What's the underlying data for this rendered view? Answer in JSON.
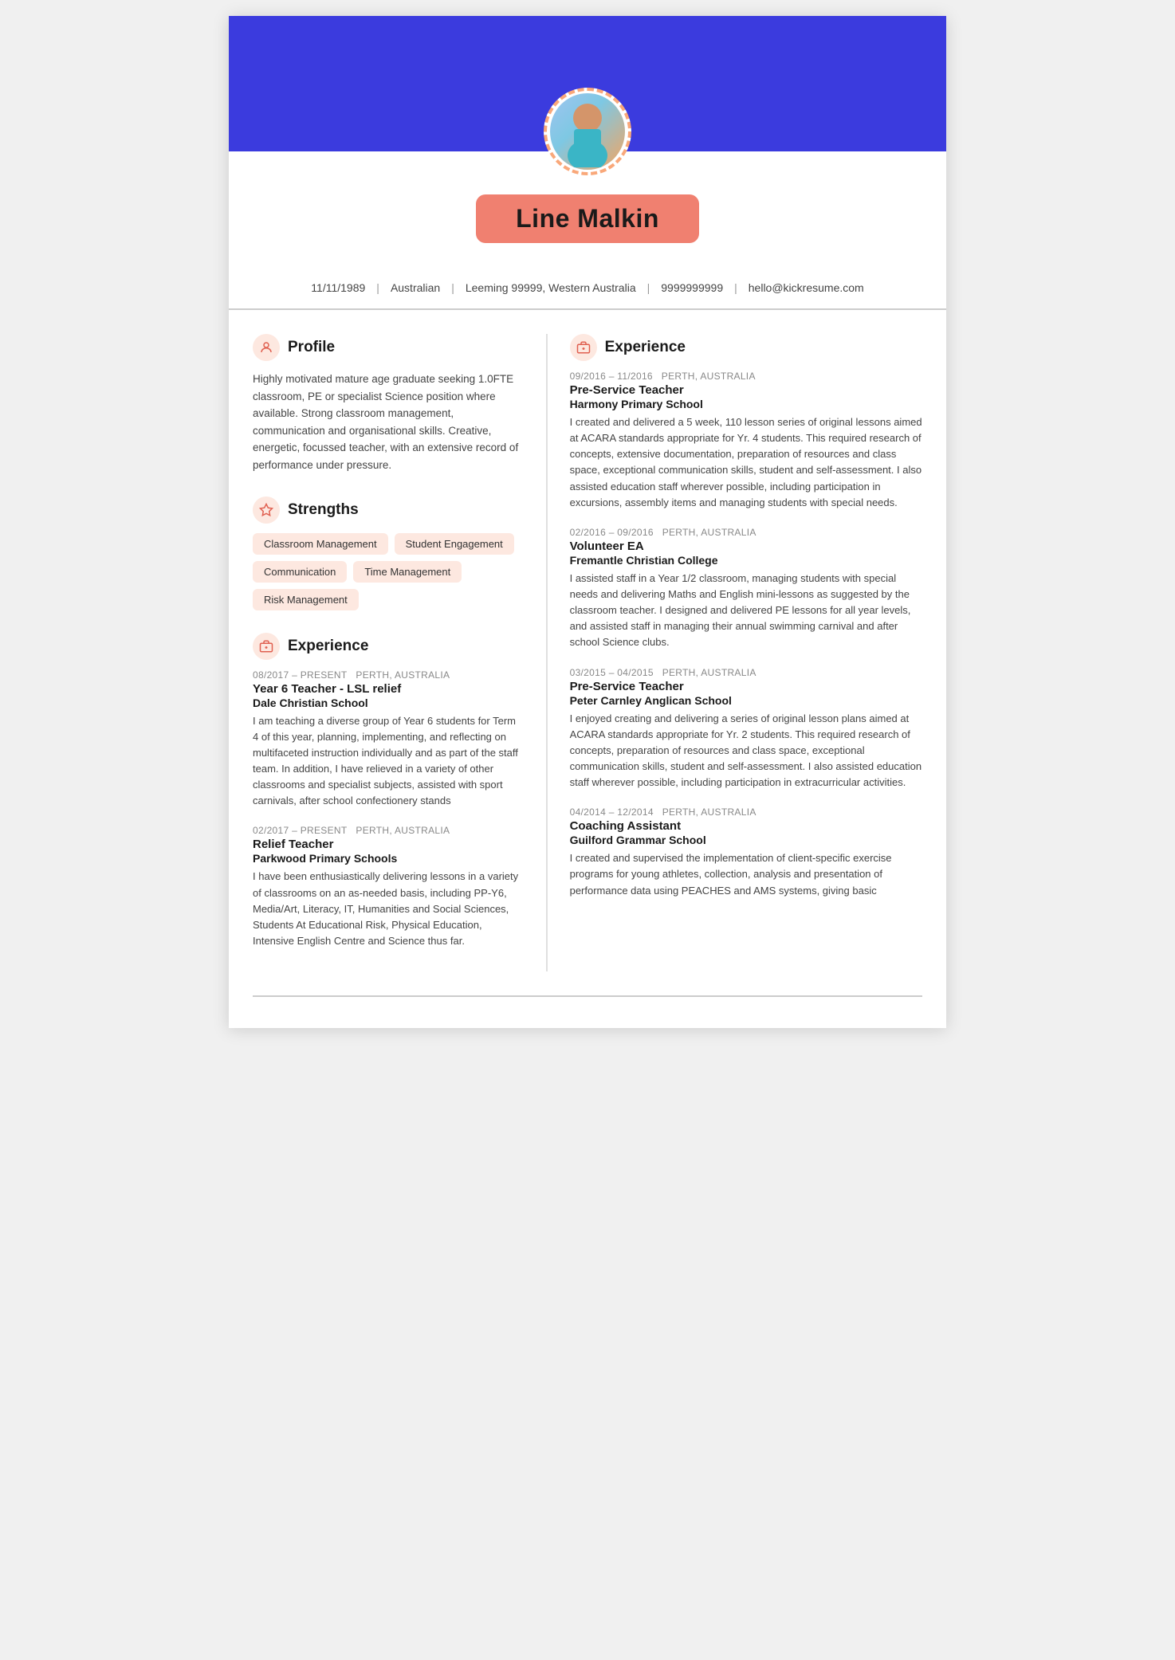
{
  "header": {
    "name": "Line Malkin",
    "background_color": "#3b3bde",
    "name_bg_color": "#f08070"
  },
  "contact": {
    "dob": "11/11/1989",
    "nationality": "Australian",
    "address": "Leeming 99999, Western Australia",
    "phone": "9999999999",
    "email": "hello@kickresume.com"
  },
  "left": {
    "profile": {
      "title": "Profile",
      "text": "Highly motivated mature age graduate seeking 1.0FTE classroom, PE or specialist Science position where available. Strong classroom management, communication and organisational skills. Creative, energetic, focussed teacher, with an extensive record of performance under pressure."
    },
    "strengths": {
      "title": "Strengths",
      "tags": [
        "Classroom Management",
        "Student Engagement",
        "Communication",
        "Time Management",
        "Risk Management"
      ]
    },
    "experience": {
      "title": "Experience",
      "entries": [
        {
          "date": "08/2017 – PRESENT",
          "location": "PERTH, AUSTRALIA",
          "title": "Year 6 Teacher - LSL relief",
          "company": "Dale Christian School",
          "desc": "I am teaching a diverse group of Year 6 students for Term 4 of this year, planning, implementing, and reflecting on multifaceted instruction individually and as part of the staff team. In addition, I have relieved in a variety of other classrooms and specialist subjects, assisted with sport carnivals, after school confectionery stands"
        },
        {
          "date": "02/2017 – PRESENT",
          "location": "PERTH, AUSTRALIA",
          "title": "Relief Teacher",
          "company": "Parkwood Primary Schools",
          "desc": "I have been enthusiastically delivering lessons in a variety of classrooms on an as-needed basis, including PP-Y6, Media/Art, Literacy, IT, Humanities and Social Sciences, Students At Educational Risk, Physical Education, Intensive English Centre and Science thus far."
        }
      ]
    }
  },
  "right": {
    "experience": {
      "title": "Experience",
      "entries": [
        {
          "date": "09/2016 – 11/2016",
          "location": "PERTH, AUSTRALIA",
          "title": "Pre-Service Teacher",
          "company": "Harmony Primary School",
          "desc": "I created and delivered a 5 week, 110 lesson series of original lessons aimed at ACARA standards appropriate for Yr. 4 students. This required research of concepts, extensive documentation, preparation of resources and class space, exceptional communication skills, student and self-assessment. I also assisted education staff wherever possible, including participation in excursions, assembly items and managing students with special needs."
        },
        {
          "date": "02/2016 – 09/2016",
          "location": "PERTH, AUSTRALIA",
          "title": "Volunteer EA",
          "company": "Fremantle Christian College",
          "desc": "I assisted staff in a Year 1/2 classroom, managing students with special needs and delivering Maths and English mini-lessons as suggested by the classroom teacher. I designed and delivered PE lessons for all year levels, and assisted staff in managing their annual swimming carnival and after school Science clubs."
        },
        {
          "date": "03/2015 – 04/2015",
          "location": "PERTH, AUSTRALIA",
          "title": "Pre-Service Teacher",
          "company": "Peter Carnley Anglican School",
          "desc": "I enjoyed creating and delivering a series of original lesson plans aimed at ACARA standards appropriate for Yr. 2 students. This required research of concepts, preparation of resources and class space, exceptional communication skills, student and self-assessment. I also assisted education staff wherever possible, including participation in extracurricular activities."
        },
        {
          "date": "04/2014 – 12/2014",
          "location": "PERTH, AUSTRALIA",
          "title": "Coaching Assistant",
          "company": "Guilford Grammar School",
          "desc": "I created and supervised the implementation of client-specific exercise programs for young athletes, collection, analysis and presentation of performance data using PEACHES and AMS systems, giving basic"
        }
      ]
    }
  }
}
